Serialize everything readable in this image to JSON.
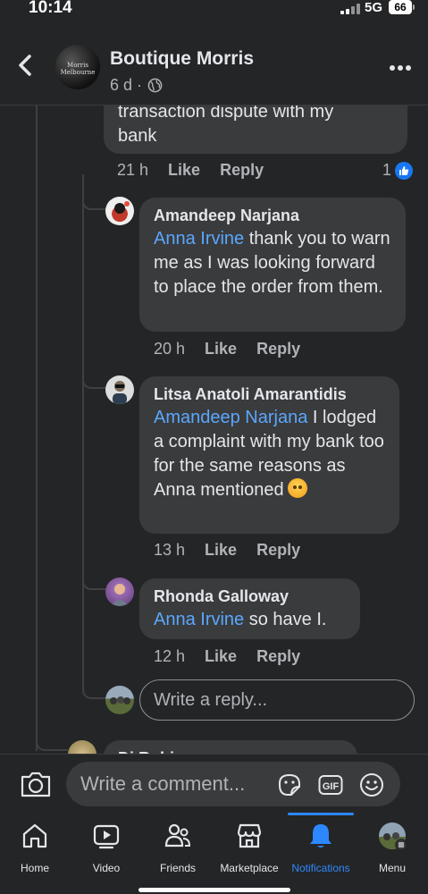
{
  "status": {
    "time": "10:14",
    "network": "5G",
    "battery": "66"
  },
  "header": {
    "page_name": "Boutique Morris",
    "avatar_text": "Morris Melbourne",
    "meta": "6 d ·",
    "icons": {
      "back": "chevron-left-icon",
      "audience": "globe-icon",
      "more": "more-dots-icon"
    }
  },
  "comments": [
    {
      "author": "",
      "text_partial": "transaction dispute with my bank",
      "time": "21 h",
      "like": "Like",
      "reply": "Reply",
      "reactions": "1"
    },
    {
      "author": "Amandeep Narjana",
      "mention": "Anna Irvine",
      "text": " thank you to warn me as I was looking forward to place the order from them.",
      "time": "20 h",
      "like": "Like",
      "reply": "Reply"
    },
    {
      "author": "Litsa Anatoli Amarantidis",
      "mention": "Amandeep Narjana",
      "text": " I lodged a complaint with my bank too for the same reasons as Anna mentioned",
      "emoji": "angry-face-emoji",
      "time": "13 h",
      "like": "Like",
      "reply": "Reply"
    },
    {
      "author": "Rhonda Galloway",
      "mention": "Anna Irvine",
      "text": " so have I.",
      "time": "12 h",
      "like": "Like",
      "reply": "Reply"
    }
  ],
  "reply_box": {
    "placeholder": "Write a reply..."
  },
  "next_comment": {
    "author_partial": "Di Robi"
  },
  "comment_bar": {
    "placeholder": "Write a comment...",
    "icons": {
      "camera": "camera-icon",
      "sticker": "sticker-icon",
      "gif": "GIF",
      "emoji": "smiley-icon"
    }
  },
  "tabs": [
    {
      "label": "Home",
      "icon": "home-icon"
    },
    {
      "label": "Video",
      "icon": "video-icon"
    },
    {
      "label": "Friends",
      "icon": "friends-icon"
    },
    {
      "label": "Marketplace",
      "icon": "marketplace-icon"
    },
    {
      "label": "Notifications",
      "icon": "bell-icon",
      "active": true
    },
    {
      "label": "Menu",
      "icon": "menu-avatar-icon"
    }
  ],
  "colors": {
    "background": "#242526",
    "bubble": "#3a3b3c",
    "mention": "#5aa7ff",
    "accent": "#2d88ff"
  }
}
